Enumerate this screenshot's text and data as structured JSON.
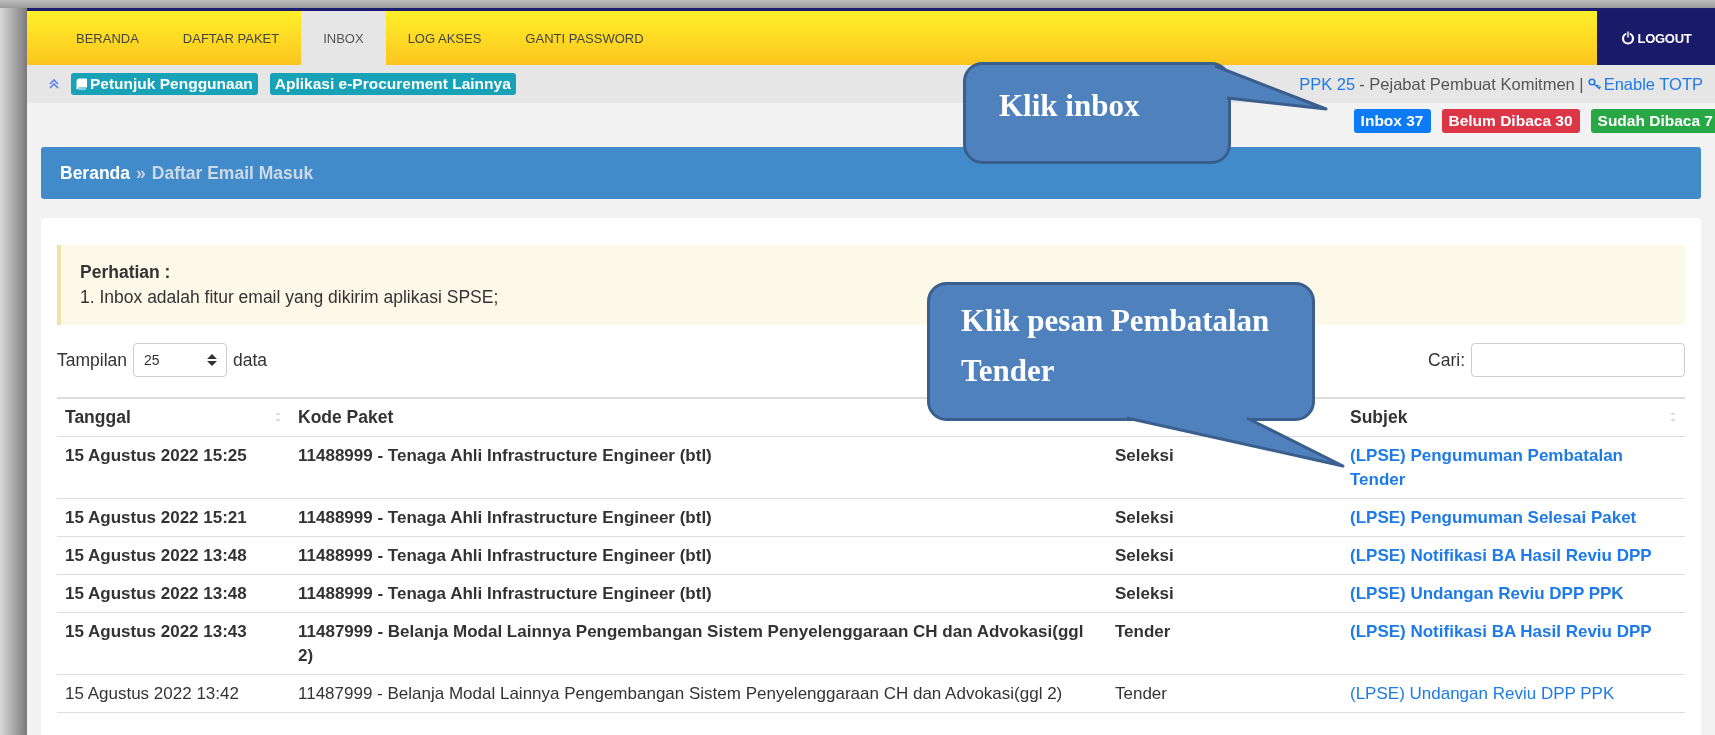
{
  "nav": {
    "tabs": [
      {
        "label": "BERANDA",
        "selected": false
      },
      {
        "label": "DAFTAR PAKET",
        "selected": false
      },
      {
        "label": "INBOX",
        "selected": true
      },
      {
        "label": "LOG AKSES",
        "selected": false
      },
      {
        "label": "GANTI PASSWORD",
        "selected": false
      }
    ],
    "logout": "LOGOUT"
  },
  "subbar": {
    "links": [
      "Petunjuk Penggunaan",
      "Aplikasi e-Procurement Lainnya"
    ],
    "user": "PPK 25",
    "role": "- Pejabat Pembuat Komitmen |",
    "totp": "Enable TOTP"
  },
  "badges": [
    {
      "label": "Inbox 37",
      "color": "#0d7bf5"
    },
    {
      "label": "Belum Dibaca 30",
      "color": "#dc3545"
    },
    {
      "label": "Sudah Dibaca 7",
      "color": "#28a745"
    }
  ],
  "breadcrumb": {
    "home": "Beranda",
    "separator": "»",
    "current": "Daftar Email Masuk"
  },
  "alert": {
    "title": "Perhatian :",
    "text": "1. Inbox adalah fitur email yang dikirim aplikasi SPSE;"
  },
  "length": {
    "label": "Tampilan",
    "value": "25",
    "suffix": "data"
  },
  "search": {
    "label": "Cari:"
  },
  "table": {
    "columns": [
      "Tanggal",
      "Kode Paket",
      "Subjek"
    ],
    "rows": [
      {
        "date": "15 Agustus 2022 15:25",
        "package": "11488999 - Tenaga Ahli Infrastructure Engineer (btl)",
        "method": "Seleksi",
        "subject": "(LPSE) Pengumuman Pembatalan Tender",
        "read": false
      },
      {
        "date": "15 Agustus 2022 15:21",
        "package": "11488999 - Tenaga Ahli Infrastructure Engineer (btl)",
        "method": "Seleksi",
        "subject": "(LPSE) Pengumuman Selesai Paket",
        "read": false
      },
      {
        "date": "15 Agustus 2022 13:48",
        "package": "11488999 - Tenaga Ahli Infrastructure Engineer (btl)",
        "method": "Seleksi",
        "subject": "(LPSE) Notifikasi BA Hasil Reviu DPP",
        "read": false
      },
      {
        "date": "15 Agustus 2022 13:48",
        "package": "11488999 - Tenaga Ahli Infrastructure Engineer (btl)",
        "method": "Seleksi",
        "subject": "(LPSE) Undangan Reviu DPP PPK",
        "read": false
      },
      {
        "date": "15 Agustus 2022 13:43",
        "package": "11487999 - Belanja Modal Lainnya Pengembangan Sistem Penyelenggaraan CH dan Advokasi(ggl 2)",
        "method": "Tender",
        "subject": "(LPSE) Notifikasi BA Hasil Reviu DPP",
        "read": false
      },
      {
        "date": "15 Agustus 2022 13:42",
        "package": "11487999 - Belanja Modal Lainnya Pengembangan Sistem Penyelenggaraan CH dan Advokasi(ggl 2)",
        "method": "Tender",
        "subject": "(LPSE) Undangan Reviu DPP PPK",
        "read": true
      }
    ]
  },
  "callouts": [
    {
      "text": "Klik inbox"
    },
    {
      "text": "Klik pesan Pembatalan Tender"
    }
  ]
}
